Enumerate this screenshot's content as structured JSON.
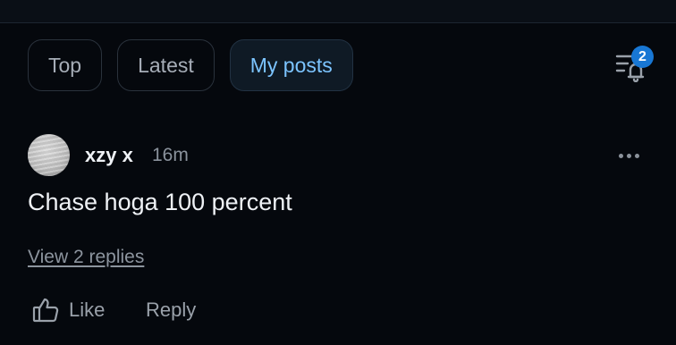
{
  "tabs": [
    {
      "label": "Top",
      "active": false
    },
    {
      "label": "Latest",
      "active": false
    },
    {
      "label": "My posts",
      "active": true
    }
  ],
  "filter": {
    "icon": "filter-bell-icon",
    "badge_count": "2"
  },
  "post": {
    "author": "xzy x",
    "time": "16m",
    "text": "Chase hoga 100 percent",
    "replies_link": "View 2 replies",
    "like_label": "Like",
    "reply_label": "Reply"
  },
  "colors": {
    "background": "#05080d",
    "active_tab_text": "#7cc4ff",
    "badge": "#1877d4"
  }
}
